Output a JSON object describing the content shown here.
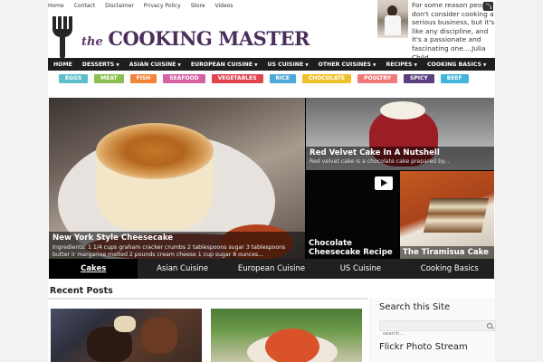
{
  "top_links": [
    "Home",
    "Contact",
    "Disclaimer",
    "Privacy Policy",
    "Store",
    "Videos"
  ],
  "logo": {
    "the": "the",
    "name": "COOKING MASTER"
  },
  "quote": "For some reason people don't consider cooking a serious business, but it's like any discipline, and it's a passionate and fascinating one....Julia Child",
  "nav": [
    {
      "label": "HOME",
      "caret": false
    },
    {
      "label": "DESSERTS",
      "caret": true
    },
    {
      "label": "ASIAN CUISINE",
      "caret": true
    },
    {
      "label": "EUROPEAN CUISINE",
      "caret": true
    },
    {
      "label": "US CUISINE",
      "caret": true
    },
    {
      "label": "OTHER CUISINES",
      "caret": true
    },
    {
      "label": "RECIPES",
      "caret": true
    },
    {
      "label": "COOKING BASICS",
      "caret": true
    }
  ],
  "tags": [
    {
      "label": "EGGS",
      "color": "#5bc0c9"
    },
    {
      "label": "MEAT",
      "color": "#8cc152"
    },
    {
      "label": "FISH",
      "color": "#f2843a"
    },
    {
      "label": "SEAFOOD",
      "color": "#d760a3"
    },
    {
      "label": "VEGETABLES",
      "color": "#e2434f"
    },
    {
      "label": "RICE",
      "color": "#4fa8d6"
    },
    {
      "label": "CHOCOLATE",
      "color": "#f0c02b"
    },
    {
      "label": "POULTRY",
      "color": "#f07a7a"
    },
    {
      "label": "SPICY",
      "color": "#5a3f7c"
    },
    {
      "label": "BEEF",
      "color": "#44b5d8"
    }
  ],
  "featured": {
    "main": {
      "title": "New York Style Cheesecake",
      "desc": "Ingredients: 1 1/4 cups graham cracker crumbs 2 tablespoons sugar 3 tablespoons butter ir margarine melted 2 pounds cream cheese 1 cup sugar 8 ounces..."
    },
    "side_top": {
      "title": "Red Velvet Cake In A Nutshell",
      "desc": "Red velvet cake is a chocolate cake prepared by..."
    },
    "video": {
      "title": "Chocolate Cheesecake Recipe"
    },
    "side_right": {
      "title": "The Tiramisua Cake"
    }
  },
  "slider_tabs": [
    "Cakes",
    "Asian Cuisine",
    "European Cuisine",
    "US Cuisine",
    "Cooking Basics"
  ],
  "recent_posts": {
    "title": "Recent Posts"
  },
  "sidebar": {
    "search_title": "Search this Site",
    "search_placeholder": "search...",
    "flickr_title": "Flickr Photo Stream"
  }
}
